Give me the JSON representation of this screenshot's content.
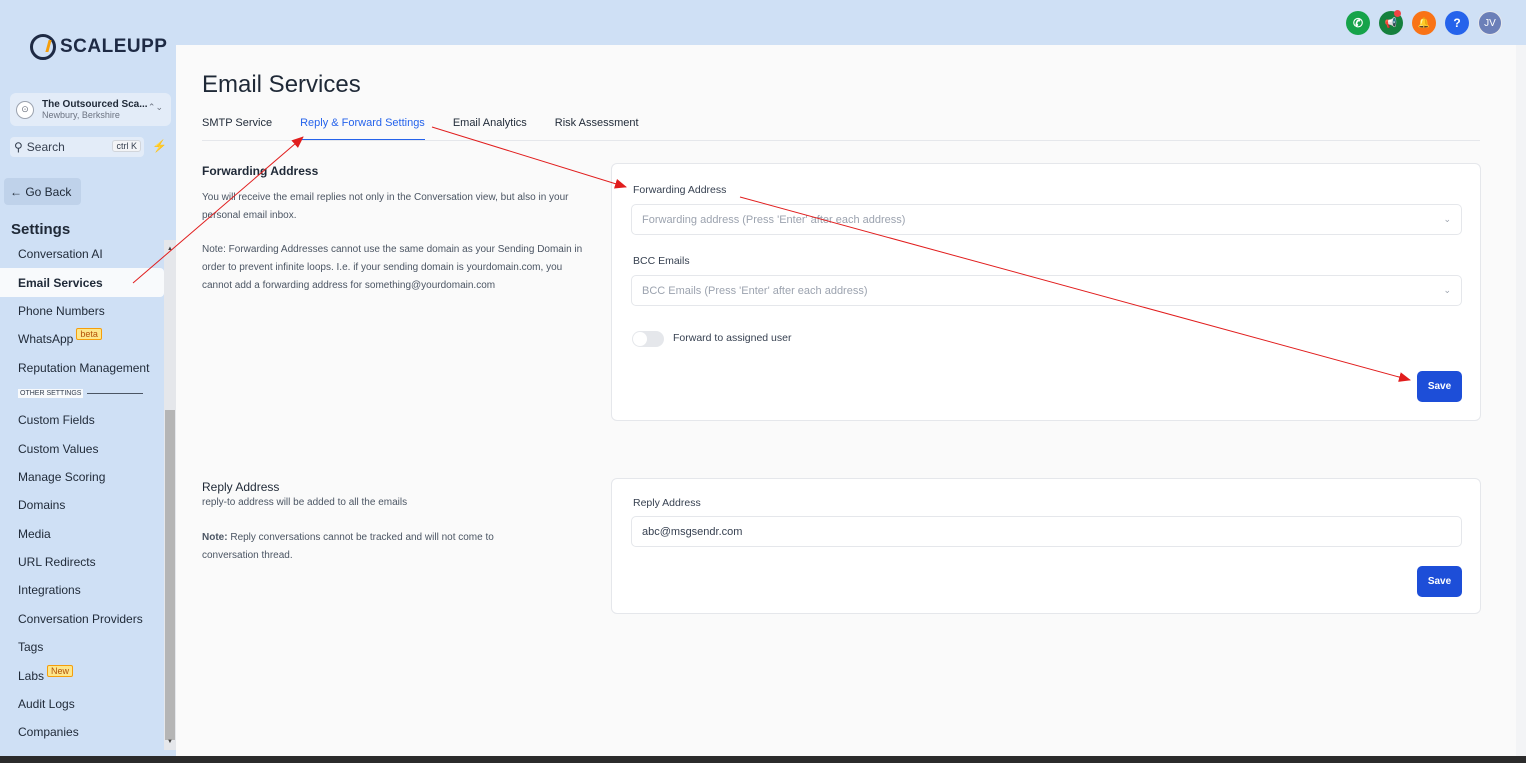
{
  "brand": {
    "name": "SCALEUPP"
  },
  "account": {
    "name": "The Outsourced Sca...",
    "location": "Newbury, Berkshire",
    "chevron": "⌃⌄"
  },
  "search": {
    "label": "Search",
    "shortcut": "ctrl K"
  },
  "go_back": "← Go Back",
  "sidebar": {
    "title": "Settings",
    "items": [
      {
        "label": "Conversation AI"
      },
      {
        "label": "Email Services",
        "active": true
      },
      {
        "label": "Phone Numbers"
      },
      {
        "label": "WhatsApp",
        "badge": "beta"
      },
      {
        "label": "Reputation Management"
      }
    ],
    "other_label": "OTHER SETTINGS",
    "other_items": [
      {
        "label": "Custom Fields"
      },
      {
        "label": "Custom Values"
      },
      {
        "label": "Manage Scoring"
      },
      {
        "label": "Domains"
      },
      {
        "label": "Media"
      },
      {
        "label": "URL Redirects"
      },
      {
        "label": "Integrations"
      },
      {
        "label": "Conversation Providers"
      },
      {
        "label": "Tags"
      },
      {
        "label": "Labs",
        "badge": "New"
      },
      {
        "label": "Audit Logs"
      },
      {
        "label": "Companies"
      }
    ]
  },
  "topbar": {
    "icons": [
      {
        "name": "phone-icon",
        "glyph": "✆",
        "color": "#16a34a"
      },
      {
        "name": "megaphone-icon",
        "glyph": "📢",
        "color": "#15803d"
      },
      {
        "name": "bell-icon",
        "glyph": "🔔",
        "color": "#f97316"
      },
      {
        "name": "help-icon",
        "glyph": "?",
        "color": "#2563eb"
      }
    ],
    "avatar": "JV"
  },
  "page": {
    "title": "Email Services",
    "tabs": [
      {
        "label": "SMTP Service"
      },
      {
        "label": "Reply & Forward Settings",
        "active": true
      },
      {
        "label": "Email Analytics"
      },
      {
        "label": "Risk Assessment"
      }
    ]
  },
  "forwarding": {
    "title": "Forwarding Address",
    "desc": "You will receive the email replies not only in the Conversation view, but also in your personal email inbox.",
    "note": "Note: Forwarding Addresses cannot use the same domain as your Sending Domain in order to prevent infinite loops. I.e. if your sending domain is yourdomain.com, you cannot add a forwarding address for something@yourdomain.com",
    "field_label": "Forwarding Address",
    "field_placeholder": "Forwarding address (Press 'Enter' after each address)",
    "bcc_label": "BCC Emails",
    "bcc_placeholder": "BCC Emails (Press 'Enter' after each address)",
    "toggle_label": "Forward to assigned user",
    "toggle_on": false,
    "save": "Save"
  },
  "reply": {
    "title": "Reply Address",
    "desc": "reply-to address will be added to all the emails",
    "note_bold": "Note:",
    "note": " Reply conversations cannot be tracked and will not come to conversation thread.",
    "field_label": "Reply Address",
    "value": "abc@msgsendr.com",
    "save": "Save"
  },
  "colors": {
    "accent": "#2563eb",
    "sidebar": "#cfe0f5",
    "save_button": "#1d4ed8",
    "annotation_arrow": "#e11d1d"
  }
}
